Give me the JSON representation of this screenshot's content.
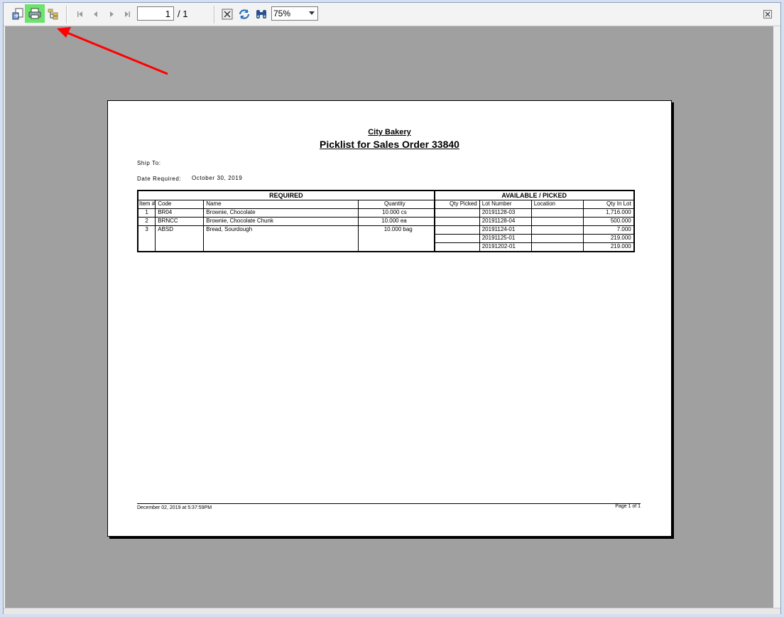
{
  "toolbar": {
    "page_current": "1",
    "page_total": "/ 1",
    "zoom": "75%"
  },
  "report": {
    "company": "City Bakery",
    "title": "Picklist for Sales Order 33840",
    "ship_to_label": "Ship To:",
    "date_required_label": "Date Required:",
    "date_required_value": "October 30, 2019",
    "headers": {
      "required": "REQUIRED",
      "available": "AVAILABLE / PICKED",
      "item": "Item #",
      "code": "Code",
      "name": "Name",
      "quantity": "Quantity",
      "qty_picked": "Qty Picked",
      "lot_number": "Lot Number",
      "location": "Location",
      "qty_in_lot": "Qty In Lot"
    },
    "items": [
      {
        "item": "1",
        "code": "BR04",
        "name": "Brownie, Chocolate",
        "quantity": "10.000 cs"
      },
      {
        "item": "2",
        "code": "BRNCC",
        "name": "Brownie, Chocolate Chunk",
        "quantity": "10.000 ea"
      },
      {
        "item": "3",
        "code": "ABSD",
        "name": "Bread, Sourdough",
        "quantity": "10.000 bag"
      }
    ],
    "lots": [
      {
        "lot": "20191128-03",
        "qty": "1,716.000"
      },
      {
        "lot": "20191128-04",
        "qty": "500.000"
      },
      {
        "lot": "20191124-01",
        "qty": "7.000"
      },
      {
        "lot": "20191125-01",
        "qty": "219.000"
      },
      {
        "lot": "20191202-01",
        "qty": "219.000"
      }
    ],
    "footer_left": "December 02, 2019 at  5:37:59PM",
    "footer_right": "Page 1 of 1"
  }
}
